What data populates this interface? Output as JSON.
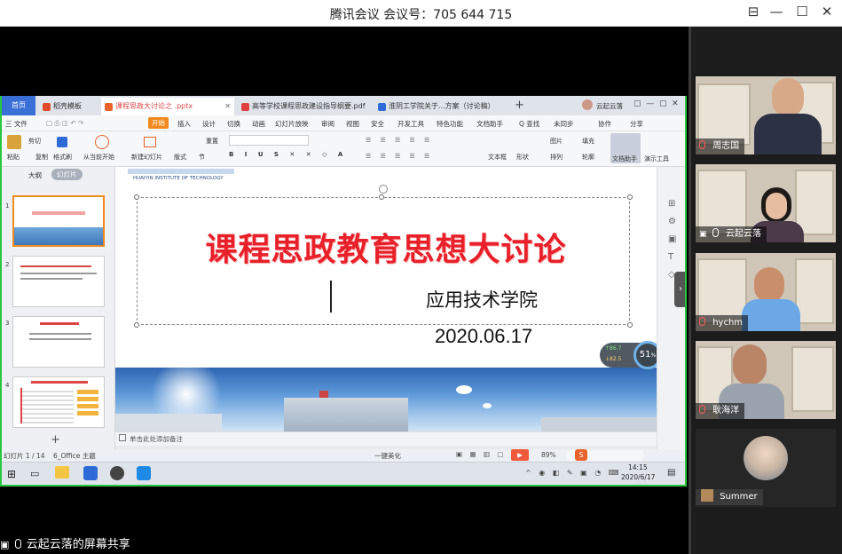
{
  "window": {
    "title": "腾讯会议 会议号：705 644 715",
    "minimize": "—",
    "maximize": "☐",
    "close": "✕",
    "pin": "⊟"
  },
  "shared_screen": {
    "label": "云起云落的屏幕共享",
    "wps": {
      "home_tab": "首页",
      "tabs": [
        {
          "label": "稻壳模板",
          "color": "#e04a2b"
        },
        {
          "label": "课程思政大讨论之 .pptx",
          "color": "#e8632b"
        },
        {
          "label": "高等学校课程思政建设指导纲要.pdf",
          "color": "#e04040"
        },
        {
          "label": "淮阴工学院关于...方案（讨论稿）",
          "color": "#2f6bd6"
        }
      ],
      "tab_add": "+",
      "account": "云起云落",
      "menu": {
        "file": "三 文件",
        "items": [
          "开始",
          "插入",
          "设计",
          "切换",
          "动画",
          "幻灯片放映",
          "审阅",
          "视图",
          "安全",
          "开发工具",
          "特色功能",
          "文档助手"
        ],
        "search": "Q 查找",
        "coop": "协作",
        "share": "分享",
        "unsynced": "未同步"
      },
      "ribbon": {
        "paste": "粘贴",
        "cut": "剪切",
        "copy": "复制",
        "format_painter": "格式刷",
        "play_from_current": "从当前开始",
        "new_slide": "新建幻灯片",
        "layout": "版式",
        "section": "节",
        "reset": "重置",
        "text_box": "文本框",
        "shapes": "形状",
        "arrange": "排列",
        "fill": "填充",
        "outline": "轮廓",
        "doc_assistant": "文档助手",
        "presentation_tools": "演示工具",
        "picture": "图片"
      },
      "thumbs": {
        "outline_tab": "大纲",
        "slides_tab": "幻灯片",
        "items": [
          {
            "num": "1",
            "kind": "title"
          },
          {
            "num": "2",
            "kind": "text"
          },
          {
            "num": "3",
            "kind": "text"
          },
          {
            "num": "4",
            "kind": "list"
          }
        ],
        "add": "+"
      },
      "slide": {
        "institute_en": "HUAIYIN INSTITUTE OF TECHNOLOGY",
        "title": "课程思政教育思想大讨论",
        "subtitle": "应用技术学院",
        "date": "2020.06.17"
      },
      "notes_placeholder": "单击此处添加备注",
      "status": {
        "slide_counter": "幻灯片 1 / 14",
        "theme": "6_Office 主题",
        "beautify": "一键美化",
        "zoom": "89%",
        "speed_up": "86.7",
        "speed_down": "82.5",
        "percent": "51",
        "percent_unit": "%"
      },
      "taskbar": {
        "time": "14:15",
        "date": "2020/6/17"
      }
    }
  },
  "participants": [
    {
      "name": "周志国",
      "muted": true
    },
    {
      "name": "云起云落",
      "muted": false,
      "sharing": true
    },
    {
      "name": "hychm",
      "muted": true
    },
    {
      "name": "耿海洋",
      "muted": true
    },
    {
      "name": "Summer",
      "avatar_only": true
    }
  ],
  "colors": {
    "share_border": "#28c740",
    "title_red": "#e8202a",
    "wps_accent": "#3a6fd8",
    "play_red": "#f05a3c"
  }
}
